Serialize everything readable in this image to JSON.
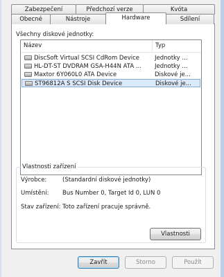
{
  "tabs": {
    "row1": [
      "Zabezpečení",
      "Předchozí verze",
      "Kvóta"
    ],
    "row2": [
      "Obecné",
      "Nástroje",
      "Hardware",
      "Sdílení"
    ],
    "active": "Hardware"
  },
  "hardware": {
    "list_title": "Všechny diskové jednotky:",
    "columns": {
      "name": "Název",
      "type": "Typ"
    },
    "devices": [
      {
        "name": "DiscSoft Virtual SCSI CdRom Device",
        "type": "Jednotky ...",
        "icon": "dvd-drive-icon"
      },
      {
        "name": "HL-DT-ST DVDRAM GSA-H44N ATA ...",
        "type": "Jednotky ...",
        "icon": "dvd-drive-icon"
      },
      {
        "name": "Maxtor 6Y060L0 ATA Device",
        "type": "Diskové je...",
        "icon": "hard-disk-icon"
      },
      {
        "name": "ST96812A S SCSI Disk Device",
        "type": "Diskové je...",
        "icon": "hard-disk-icon"
      }
    ],
    "selected_index": 3
  },
  "properties": {
    "legend": "Vlastnosti zařízení",
    "manufacturer_label": "Výrobce:",
    "manufacturer_value": "(Standardní diskové jednotky)",
    "location_label": "Umístění:",
    "location_value": "Bus Number 0, Target Id 0, LUN 0",
    "status_label": "Stav zařízení:",
    "status_value": "Toto zařízení pracuje správně.",
    "properties_button": "Vlastnosti"
  },
  "footer": {
    "close": "Zavřít",
    "cancel": "Storno",
    "apply": "Použít"
  }
}
